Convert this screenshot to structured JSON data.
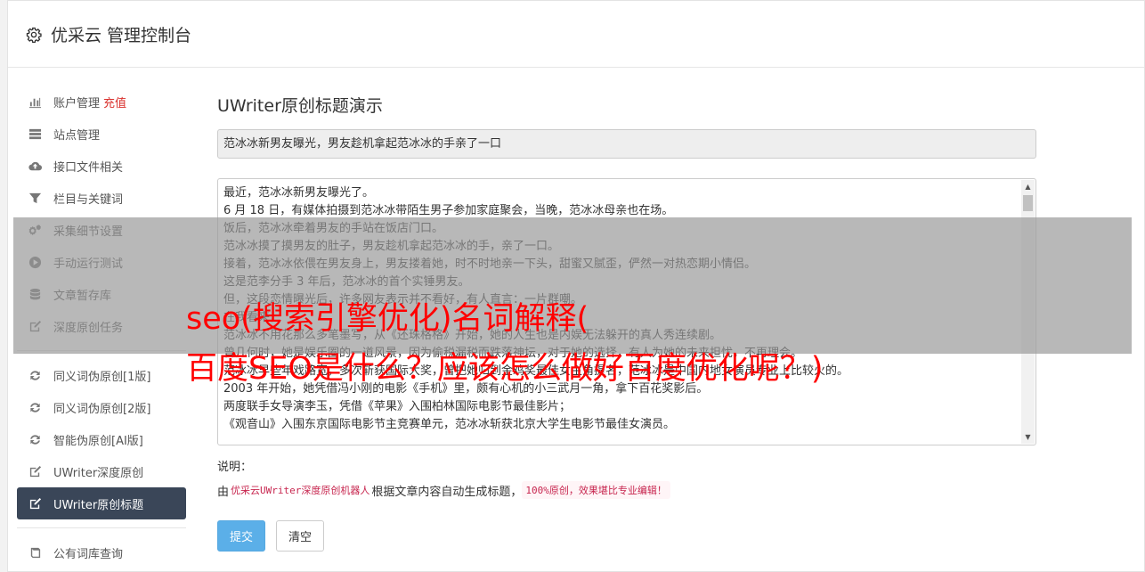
{
  "header": {
    "title": "优采云 管理控制台",
    "icon": "gear-icon"
  },
  "sidebar": {
    "items": [
      {
        "label": "账户管理",
        "badge": "充值",
        "icon": "bar-chart-icon"
      },
      {
        "label": "站点管理",
        "icon": "server-icon"
      },
      {
        "label": "接口文件相关",
        "icon": "cloud-upload-icon"
      },
      {
        "label": "栏目与关键词",
        "icon": "filter-icon"
      },
      {
        "label": "采集细节设置",
        "icon": "cogs-icon"
      },
      {
        "label": "手动运行测试",
        "icon": "play-icon"
      },
      {
        "label": "文章暂存库",
        "icon": "database-icon"
      },
      {
        "label": "深度原创任务",
        "icon": "edit-icon"
      },
      {
        "label": "同义词伪原创[1版]",
        "icon": "refresh-icon"
      },
      {
        "label": "同义词伪原创[2版]",
        "icon": "refresh-icon"
      },
      {
        "label": "智能伪原创[AI版]",
        "icon": "refresh-icon"
      },
      {
        "label": "UWriter深度原创",
        "icon": "edit-icon"
      },
      {
        "label": "UWriter原创标题",
        "icon": "edit-icon",
        "active": true
      },
      {
        "label": "公有词库查询",
        "icon": "book-icon"
      }
    ]
  },
  "main": {
    "heading": "UWriter原创标题演示",
    "title_value": "范冰冰新男友曝光，男友趁机拿起范冰冰的手亲了一口",
    "content_lines": [
      "最近，范冰冰新男友曝光了。",
      "6 月 18 日，有媒体拍摄到范冰冰带陌生男子参加家庭聚会，当晚，范冰冰母亲也在场。",
      "饭后，范冰冰牵着男友的手站在饭店门口。",
      "范冰冰摸了摸男友的肚子，男友趁机拿起范冰冰的手，亲了一口。",
      "接着，范冰冰依偎在男友身上，男友搂着她，时不时地亲一下头，甜蜜又腻歪，俨然一对热恋期小情侣。",
      "这是范李分手 3 年后，范冰冰的首个实锤男友。",
      "但，这段恋情曝光后，许多网友表示并不看好，有人直言：一片群嘲。",
      "在我看来，",
      "范冰冰不用花那么多笔墨写，从《还珠格格》开始，她的人生也是内娱无法躲开的真人秀连续剧。",
      "曾几何时，她是娱乐圈的一道风景，因为偷税漏税而跌落神坛，对于她的选择，有人为她的未来担忧，不再理会。",
      "范冰冰早些年戏路宽，多次斩获国际大奖，曾把她归到金鸡奖最佳女主角提名，范冰冰是中国内地女演员专业上比较火的。",
      "2003 年开始，她凭借冯小刚的电影《手机》里，颇有心机的小三武月一角，拿下百花奖影后。",
      "两度联手女导演李玉，凭借《苹果》入围柏林国际电影节最佳影片；",
      "《观音山》入围东京国际电影节主竞赛单元，范冰冰斩获北京大学生电影节最佳女演员。"
    ],
    "note_label": "说明：",
    "note_prefix": "由",
    "note_robot": "优采云UWriter深度原创机器人",
    "note_middle": "根据文章内容自动生成标题，",
    "note_badge": "100%原创，效果堪比专业编辑！",
    "submit_label": "提交",
    "clear_label": "清空"
  },
  "overlay": {
    "line1": "seo(搜索引擎优化)名词解释(",
    "line2": "百度SEO是什么？应该怎么做好百度优化呢？)"
  }
}
